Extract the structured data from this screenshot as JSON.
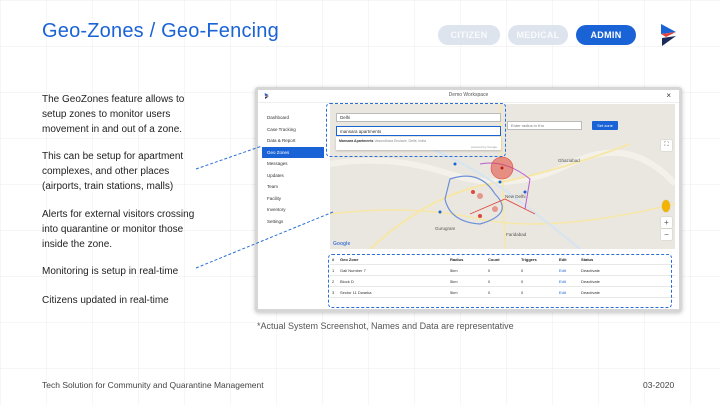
{
  "title": "Geo-Zones / Geo-Fencing",
  "role_tabs": [
    {
      "label": "CITIZEN",
      "active": false
    },
    {
      "label": "MEDICAL",
      "active": false
    },
    {
      "label": "ADMIN",
      "active": true
    }
  ],
  "descriptions": [
    "The GeoZones feature allows to setup zones to monitor users movement in and out of a zone.",
    "This can be setup for apartment complexes, and other places (airports, train stations, malls)",
    "Alerts for external visitors crossing into quarantine or monitor those inside the zone.",
    "Monitoring is setup in real-time",
    "Citizens updated in real-time"
  ],
  "screenshot": {
    "window_title": "Demo Workspace",
    "close_label": "×",
    "sidebar": [
      "Dashboard",
      "Case Tracking",
      "Data & Report",
      "Geo Zones",
      "Messages",
      "Updates",
      "Team",
      "Facility",
      "Inventory",
      "Settings"
    ],
    "active_sidebar": "Geo Zones",
    "map": {
      "city_field": "Delhi",
      "search_field": "mansara apartments",
      "suggestion_name": "Mansara Apartments",
      "suggestion_detail": "Vasundhara Enclave, Delhi, India",
      "powered_by": "powered by Google",
      "radius_placeholder": "Enter radius in Km",
      "set_zone_label": "Set zone",
      "google_label": "Google",
      "zoom_in": "+",
      "zoom_out": "−",
      "place_labels": [
        "Ghaziabad",
        "New Delhi",
        "Gurugram",
        "Faridabad"
      ]
    },
    "table": {
      "headers": [
        "#",
        "Geo Zone",
        "Radius",
        "Count",
        "Triggers",
        "Edit",
        "Status"
      ],
      "rows": [
        [
          "1",
          "Gali Number 7",
          "5km",
          "0",
          "0",
          "Edit",
          "Deactivate"
        ],
        [
          "2",
          "Block D",
          "5km",
          "0",
          "0",
          "Edit",
          "Deactivate"
        ],
        [
          "3",
          "Sector 11 Dwarka",
          "5km",
          "0",
          "0",
          "Edit",
          "Deactivate"
        ]
      ]
    }
  },
  "caption": "*Actual System Screenshot, Names and Data are representative",
  "footer_left": "Tech Solution for Community and Quarantine Management",
  "footer_right": "03-2020",
  "colors": {
    "accent": "#1a63d6",
    "tab_inactive": "#dde4ee",
    "zone_red": "#e0463b"
  }
}
